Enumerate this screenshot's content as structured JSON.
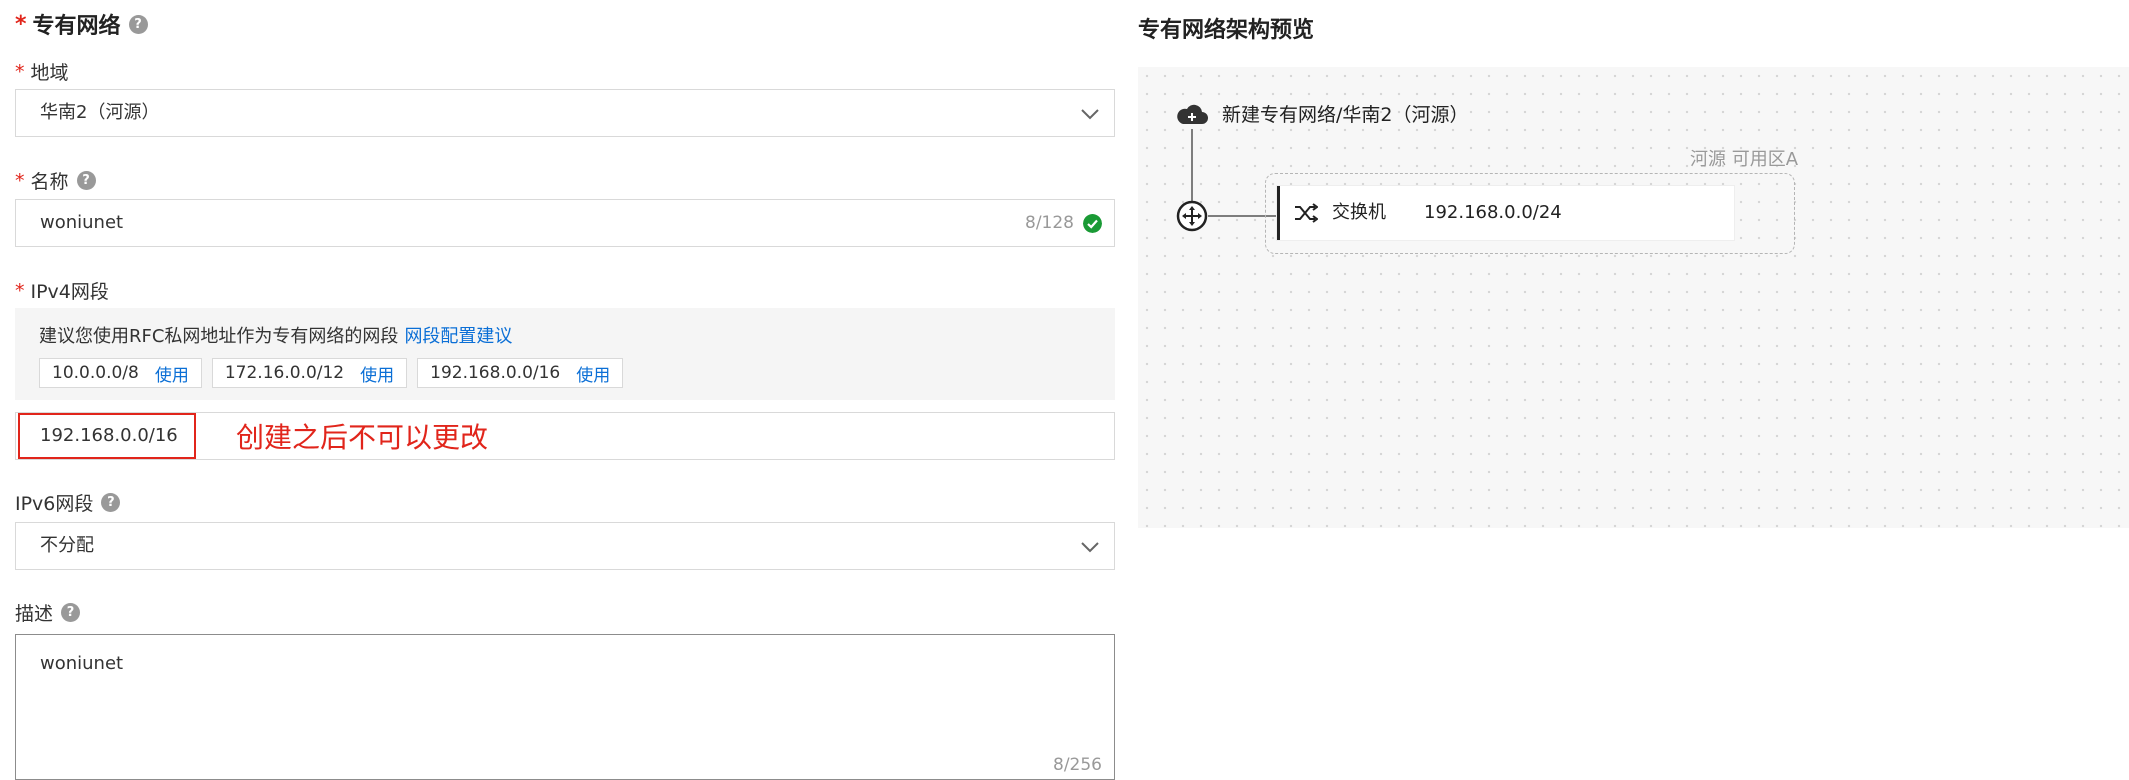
{
  "form": {
    "required_mark": "*",
    "section_title": "专有网络",
    "region": {
      "label": "地域",
      "value": "华南2（河源）"
    },
    "name": {
      "label": "名称",
      "value": "woniunet",
      "counter": "8/128"
    },
    "ipv4": {
      "label": "IPv4网段",
      "suggestion_text": "建议您使用RFC私网地址作为专有网络的网段",
      "suggestion_link": "网段配置建议",
      "chips": [
        {
          "cidr": "10.0.0.0/8",
          "action": "使用"
        },
        {
          "cidr": "172.16.0.0/12",
          "action": "使用"
        },
        {
          "cidr": "192.168.0.0/16",
          "action": "使用"
        }
      ],
      "value": "192.168.0.0/16"
    },
    "annotation": "创建之后不可以更改",
    "ipv6": {
      "label": "IPv6网段",
      "value": "不分配"
    },
    "description": {
      "label": "描述",
      "value": "woniunet",
      "counter": "8/256"
    },
    "help_glyph": "?"
  },
  "preview": {
    "title": "专有网络架构预览",
    "vpc_label": "新建专有网络/华南2（河源）",
    "zone_label": "河源 可用区A",
    "switch": {
      "name": "交换机",
      "cidr": "192.168.0.0/24"
    }
  },
  "colors": {
    "required": "#e1251b",
    "link": "#0b6fd6",
    "success": "#1a9a35",
    "annotation": "#e1251b"
  }
}
